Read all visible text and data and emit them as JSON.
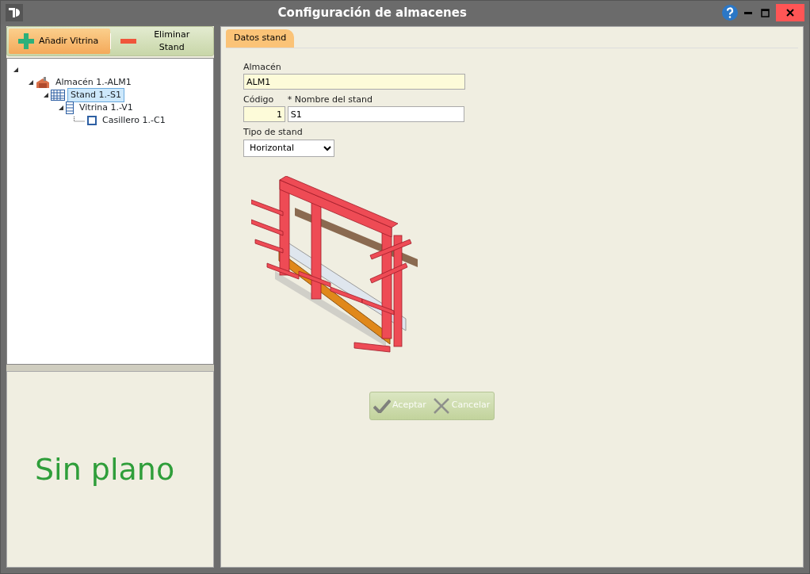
{
  "window": {
    "title": "Configuración de almacenes"
  },
  "toolbar": [
    {
      "label": "Añadir Vitrina",
      "kind": "add",
      "selected": true
    },
    {
      "label": "Eliminar Stand",
      "kind": "remove",
      "selected": false
    }
  ],
  "tree": {
    "expanded": true,
    "children": [
      {
        "label": "Almacén 1.-ALM1",
        "kind": "warehouse",
        "expanded": true,
        "selected": false,
        "children": [
          {
            "label": "Stand 1.-S1",
            "kind": "stand",
            "expanded": true,
            "selected": true,
            "children": [
              {
                "label": "Vitrina 1.-V1",
                "kind": "showcase",
                "expanded": true,
                "selected": false,
                "children": [
                  {
                    "label": "Casillero 1.-C1",
                    "kind": "locker",
                    "selected": false
                  }
                ]
              }
            ]
          }
        ]
      }
    ]
  },
  "plan_panel": {
    "message": "Sin plano"
  },
  "tabs": [
    {
      "label": "Datos stand",
      "selected": true
    }
  ],
  "form": {
    "almacen": {
      "label": "Almacén",
      "value": "ALM1"
    },
    "codigo": {
      "label": "Código",
      "value": "1"
    },
    "nombre": {
      "label": "* Nombre del stand",
      "value": "S1"
    },
    "tipo": {
      "label": "Tipo de stand",
      "value": "Horizontal"
    }
  },
  "actions": {
    "disabled": true,
    "buttons": [
      {
        "label": "Aceptar",
        "kind": "accept"
      },
      {
        "label": "Cancelar",
        "kind": "cancel"
      }
    ]
  }
}
